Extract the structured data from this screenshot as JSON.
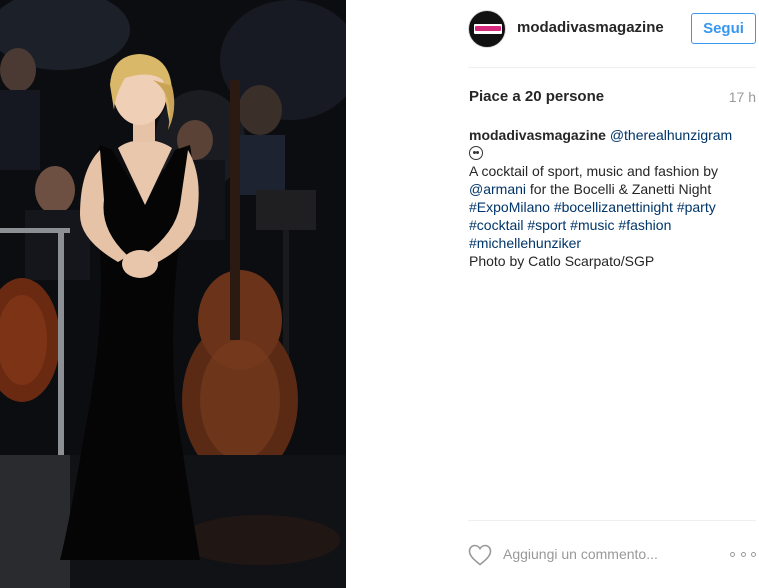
{
  "post": {
    "author": "modadivasmagazine",
    "follow_label": "Segui",
    "likes": "Piace a 20 persone",
    "time_ago": "17 h"
  },
  "caption": {
    "author": "modadivasmagazine",
    "mention_tag": "@therealhunzigram",
    "line2_text": "A cocktail of sport, music and fashion by",
    "line3_mention": "@armani",
    "line3_text": " for the Bocelli & Zanetti Night",
    "tag_expomilano": "#ExpoMilano",
    "tag_bocellizanettinight": "#bocellizanettinight",
    "tag_party": "#party",
    "tag_cocktail": "#cocktail",
    "tag_sport": "#sport",
    "tag_music": "#music",
    "tag_fashion": "#fashion",
    "tag_michellehunziker": "#michellehunziker",
    "credit": "Photo by Catlo Scarpato/SGP"
  },
  "comment": {
    "placeholder": "Aggiungi un commento..."
  },
  "colors": {
    "follow_blue": "#3897f0",
    "link_navy": "#003569",
    "muted_gray": "#999999",
    "text": "#262626"
  },
  "icons": {
    "like": "heart-outline-icon",
    "more": "ellipsis-icon",
    "emoji": "smiling-face-icon"
  }
}
